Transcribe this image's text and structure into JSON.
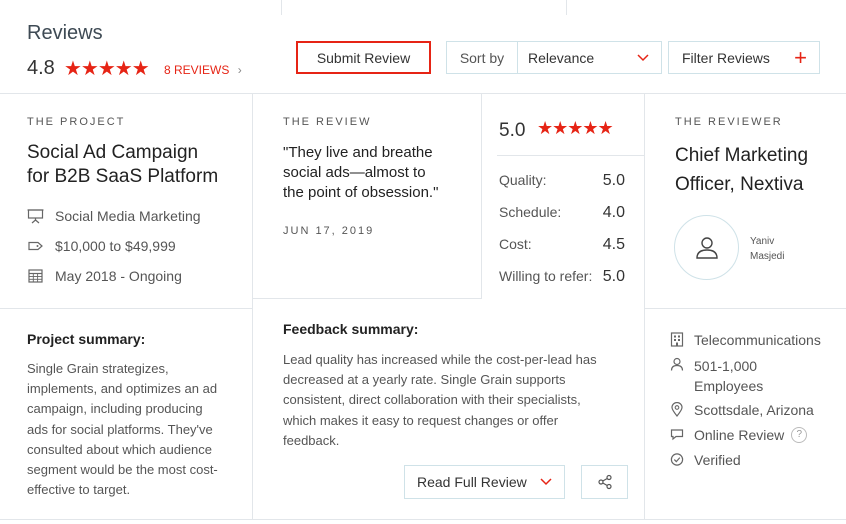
{
  "header": {
    "title": "Reviews",
    "rating": "4.8",
    "stars": "★★★★★",
    "reviews_link": "8 REVIEWS",
    "reviews_chevron": "›",
    "submit_label": "Submit Review",
    "sort_label": "Sort by",
    "sort_value": "Relevance",
    "filter_label": "Filter Reviews",
    "filter_plus": "+"
  },
  "project": {
    "caption": "THE PROJECT",
    "title_line1": "Social Ad Campaign",
    "title_line2": "for B2B SaaS Platform",
    "details": [
      {
        "icon": "presentation-icon",
        "text": "Social Media Marketing"
      },
      {
        "icon": "price-tag-icon",
        "text": "$10,000 to $49,999"
      },
      {
        "icon": "calendar-icon",
        "text": "May 2018 - Ongoing"
      }
    ],
    "summary_heading": "Project summary:",
    "summary_lines": [
      "Single Grain strategizes,",
      "implements, and optimizes an ad",
      "campaign, including producing",
      "ads for social platforms. They've",
      "consulted about which audience",
      "segment would be the most cost-",
      "effective to target."
    ]
  },
  "review": {
    "caption": "THE REVIEW",
    "quote_lines": [
      "\"They live and breathe",
      "social ads—almost to",
      "the point of obsession.\""
    ],
    "date": "JUN 17, 2019",
    "overall": "5.0",
    "stars": "★★★★★",
    "metrics": [
      {
        "label": "Quality:",
        "value": "5.0"
      },
      {
        "label": "Schedule:",
        "value": "4.0"
      },
      {
        "label": "Cost:",
        "value": "4.5"
      },
      {
        "label": "Willing to refer:",
        "value": "5.0"
      }
    ],
    "feedback_heading": "Feedback summary:",
    "feedback_lines": [
      "Lead quality has increased while the cost-per-lead has",
      "decreased at a yearly rate. Single Grain supports",
      "consistent, direct collaboration with their specialists,",
      "which makes it easy to request changes or offer",
      "feedback."
    ],
    "read_full_label": "Read Full Review"
  },
  "reviewer": {
    "caption": "THE REVIEWER",
    "title_line1": "Chief Marketing",
    "title_line2": "Officer, Nextiva",
    "name_line1": "Yaniv",
    "name_line2": "Masjedi",
    "details": [
      {
        "icon": "building-icon",
        "lines": [
          "Telecommunications"
        ]
      },
      {
        "icon": "person-icon",
        "lines": [
          "501-1,000",
          "Employees"
        ]
      },
      {
        "icon": "location-pin-icon",
        "lines": [
          "Scottsdale, Arizona"
        ]
      },
      {
        "icon": "chat-bubble-icon",
        "lines": [
          "Online Review"
        ]
      },
      {
        "icon": "check-circle-icon",
        "lines": [
          "Verified"
        ]
      }
    ],
    "help_mark": "?"
  }
}
